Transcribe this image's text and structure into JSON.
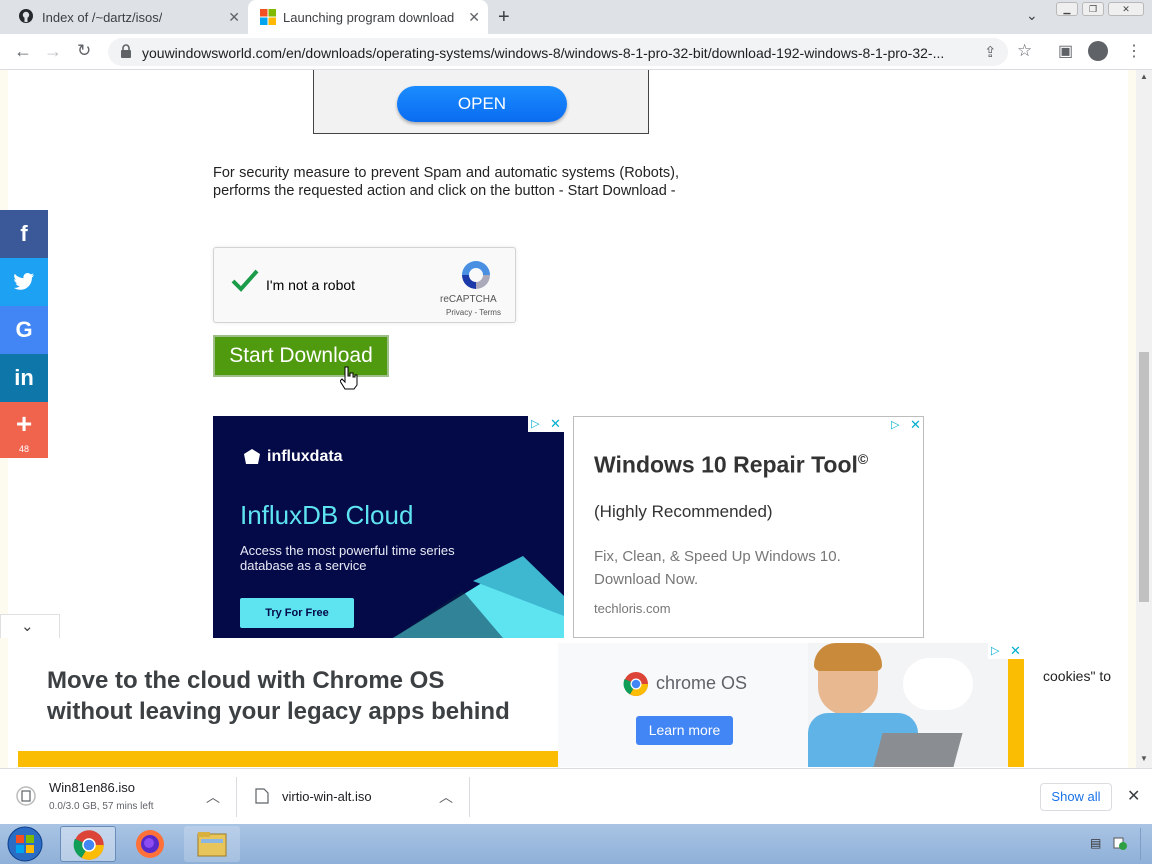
{
  "browser": {
    "tabs": [
      {
        "title": "Index of /~dartz/isos/",
        "icon": "github-icon",
        "active": false
      },
      {
        "title": "Launching program download W",
        "icon": "windows-logo-icon",
        "active": true
      }
    ],
    "url": "youwindowsworld.com/en/downloads/operating-systems/windows-8/windows-8-1-pro-32-bit/download-192-windows-8-1-pro-32-..."
  },
  "page": {
    "open_button": "OPEN",
    "security_text": "For security measure to prevent Spam and automatic systems (Robots), performs the requested action and click on the button - Start Download -",
    "recaptcha": {
      "label": "I'm not a robot",
      "brand": "reCAPTCHA",
      "terms": "Privacy - Terms",
      "checked": true
    },
    "start_download": "Start Download",
    "social": [
      {
        "icon": "facebook-icon",
        "glyph": "f",
        "color": "#3b5998"
      },
      {
        "icon": "twitter-icon",
        "glyph": "🐦",
        "color": "#1da1f2"
      },
      {
        "icon": "google-icon",
        "glyph": "G",
        "color": "#4285f4"
      },
      {
        "icon": "linkedin-icon",
        "glyph": "in",
        "color": "#0e76a8"
      },
      {
        "icon": "share-plus-icon",
        "glyph": "+",
        "color": "#f0634d",
        "count": "48"
      }
    ],
    "cookies_text": "cookies\" to"
  },
  "ads": {
    "influx": {
      "brand": "influxdata",
      "title": "InfluxDB Cloud",
      "body": "Access the most powerful time series database as a service",
      "cta": "Try For Free"
    },
    "repair": {
      "title": "Windows 10 Repair Tool",
      "trademark": "©",
      "subtitle": "(Highly Recommended)",
      "body": "Fix, Clean, & Speed Up Windows 10. Download Now.",
      "domain": "techloris.com"
    },
    "chromeos": {
      "headline_1": "Move to the cloud with Chrome OS",
      "headline_2": "without leaving your legacy apps behind",
      "brand": "chrome OS",
      "cta": "Learn more"
    }
  },
  "downloads": {
    "items": [
      {
        "name": "Win81en86.iso",
        "status": "0.0/3.0 GB, 57 mins left"
      },
      {
        "name": "virtio-win-alt.iso",
        "status": ""
      }
    ],
    "show_all": "Show all"
  },
  "colors": {
    "start_download_bg": "#4f9a0f",
    "open_button": "#0a6cf0",
    "influx_bg": "#040a47",
    "influx_cyan": "#5ee4f1"
  }
}
